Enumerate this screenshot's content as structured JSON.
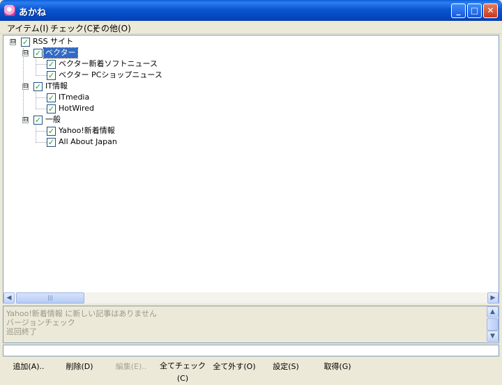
{
  "window": {
    "title": "あかね",
    "minimize": "_",
    "maximize": "□",
    "close": "✕"
  },
  "menu": [
    {
      "label": "アイテム(I)"
    },
    {
      "label": "チェック(C)"
    },
    {
      "label": "その他(O)"
    }
  ],
  "tree": {
    "root": {
      "label": "RSS サイト",
      "checked": true
    },
    "groups": [
      {
        "label": "ベクター",
        "checked": true,
        "selected": true,
        "children": [
          {
            "label": "ベクター新着ソフトニュース",
            "checked": true
          },
          {
            "label": "ベクター PCショップニュース",
            "checked": true
          }
        ]
      },
      {
        "label": "IT情報",
        "checked": true,
        "children": [
          {
            "label": "ITmedia",
            "checked": true
          },
          {
            "label": "HotWired",
            "checked": true
          }
        ]
      },
      {
        "label": "一般",
        "checked": true,
        "children": [
          {
            "label": "Yahoo!新着情報",
            "checked": true
          },
          {
            "label": "All About Japan",
            "checked": true
          }
        ]
      }
    ]
  },
  "log": [
    "Yahoo!新着情報 に新しい記事はありません",
    "バージョンチェック",
    "巡回終了"
  ],
  "status_value": "",
  "buttons": [
    {
      "label": "追加(A)..",
      "enabled": true
    },
    {
      "label": "削除(D)",
      "enabled": true
    },
    {
      "label": "編集(E)..",
      "enabled": false
    },
    {
      "label": "全てチェック(C)",
      "enabled": true
    },
    {
      "label": "全て外す(O)",
      "enabled": true
    },
    {
      "label": "設定(S)",
      "enabled": true
    },
    {
      "label": "取得(G)",
      "enabled": true
    }
  ],
  "icons": {
    "expander": "⊟",
    "check": "✓",
    "scroll_left": "◀",
    "scroll_right": "▶",
    "scroll_up": "▲",
    "scroll_down": "▼",
    "grip": "|||"
  },
  "colors": {
    "titlebar": "#0a5fd8",
    "selection": "#316ac5",
    "check": "#21a121"
  }
}
